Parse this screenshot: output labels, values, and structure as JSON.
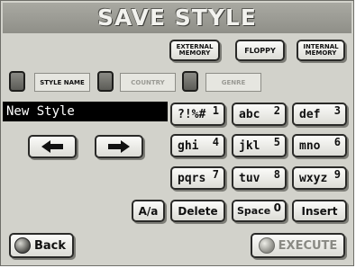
{
  "title": "SAVE STYLE",
  "destinations": [
    {
      "line1": "EXTERNAL",
      "line2": "MEMORY"
    },
    {
      "line1": "FLOPPY",
      "line2": ""
    },
    {
      "line1": "INTERNAL",
      "line2": "MEMORY"
    }
  ],
  "tabs": [
    {
      "label": "STYLE NAME"
    },
    {
      "label": "COUNTRY"
    },
    {
      "label": "GENRE"
    }
  ],
  "name_value": "New Style",
  "keypad": [
    {
      "label": "?!%#",
      "num": "1"
    },
    {
      "label": "abc",
      "num": "2"
    },
    {
      "label": "def",
      "num": "3"
    },
    {
      "label": "ghi",
      "num": "4"
    },
    {
      "label": "jkl",
      "num": "5"
    },
    {
      "label": "mno",
      "num": "6"
    },
    {
      "label": "pqrs",
      "num": "7"
    },
    {
      "label": "tuv",
      "num": "8"
    },
    {
      "label": "wxyz",
      "num": "9"
    }
  ],
  "bottom_row": {
    "case_label": "A/a",
    "delete_label": "Delete",
    "space_label": "Space",
    "space_num": "0",
    "insert_label": "Insert"
  },
  "cursor": {
    "left_icon": "arrow-left-icon",
    "right_icon": "arrow-right-icon"
  },
  "back_label": "Back",
  "execute_label": "EXECUTE",
  "colors": {
    "background": "#d2d2cb",
    "title_bar": "#9c9c95",
    "name_field": "#000000",
    "execute_text": "#8a8a84"
  }
}
